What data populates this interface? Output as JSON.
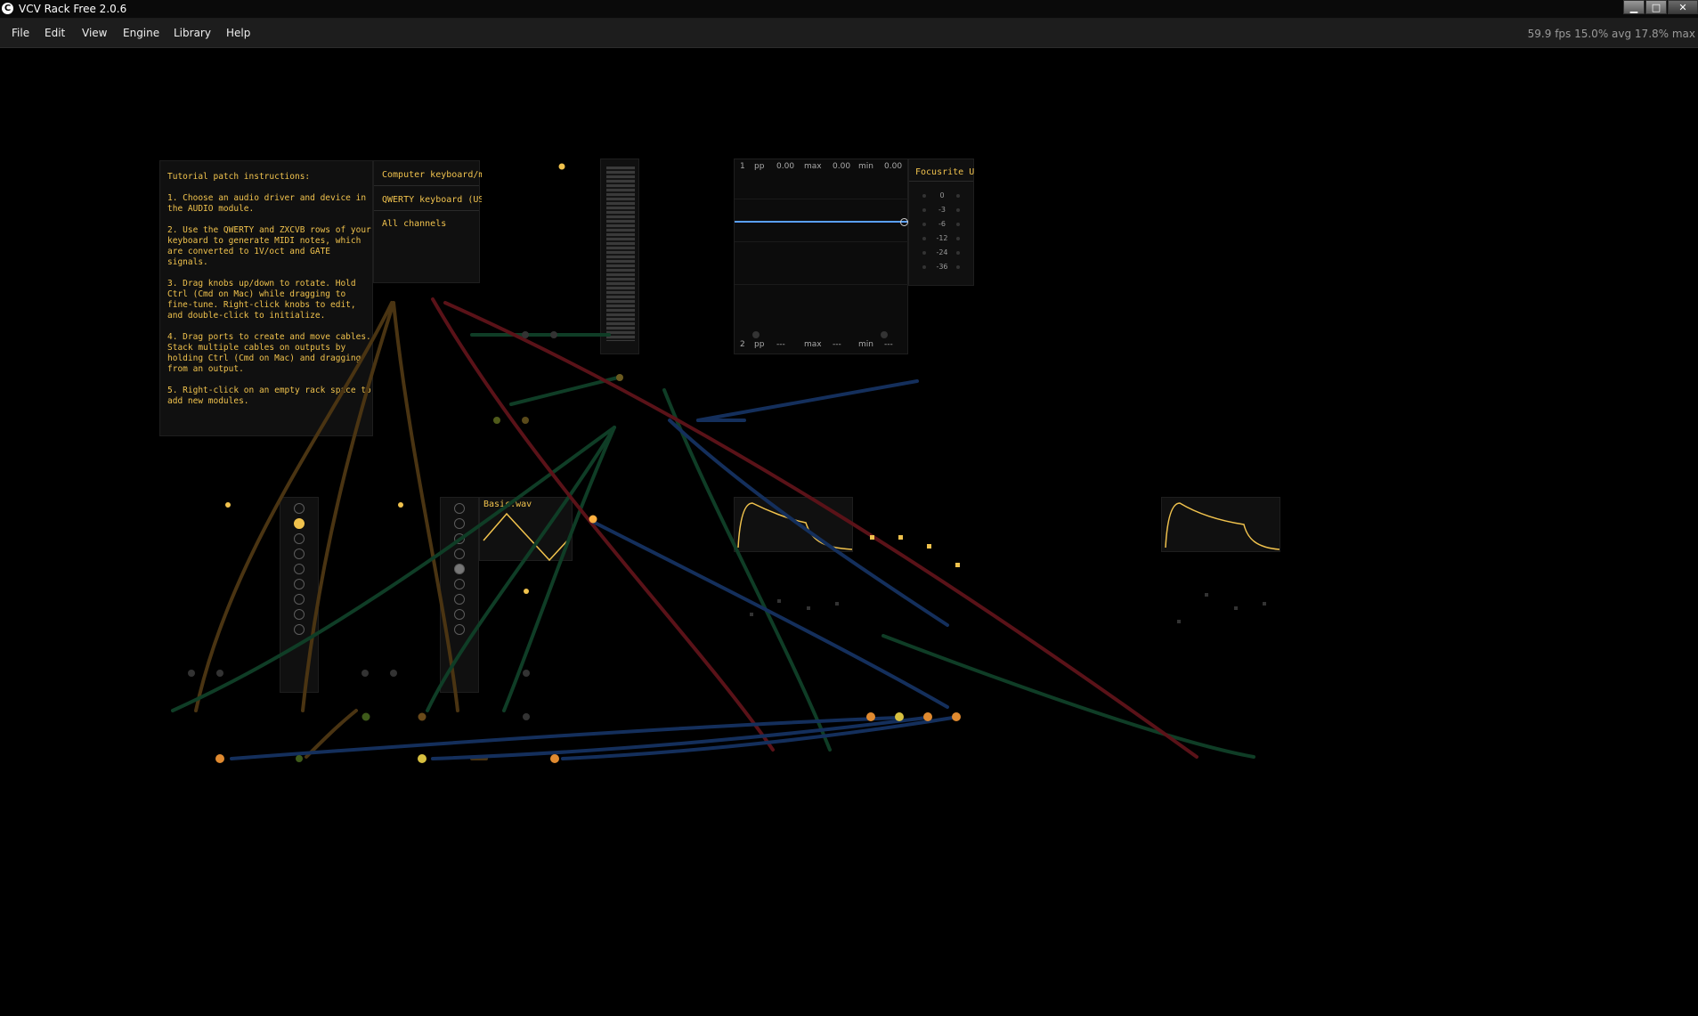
{
  "window": {
    "title": "VCV Rack Free 2.0.6",
    "logo_letter": "C",
    "minimize_glyph": "▁",
    "maximize_glyph": "□",
    "close_glyph": "✕"
  },
  "menu": {
    "file": "File",
    "edit": "Edit",
    "view": "View",
    "engine": "Engine",
    "library": "Library",
    "help": "Help"
  },
  "performance": "59.9 fps  15.0% avg  17.8% max",
  "tutorial": {
    "text": "Tutorial patch instructions:\n\n1. Choose an audio driver and device in the AUDIO module.\n\n2. Use the QWERTY and ZXCVB rows of your keyboard to generate MIDI notes, which are converted to 1V/oct and GATE signals.\n\n3. Drag knobs up/down to rotate. Hold Ctrl (Cmd on Mac) while dragging to fine-tune. Right-click knobs to edit, and double-click to initialize.\n\n4. Drag ports to create and move cables. Stack multiple cables on outputs by holding Ctrl (Cmd on Mac) and dragging from an output.\n\n5. Right-click on an empty rack space to add new modules."
  },
  "midi": {
    "driver": "Computer keyboard/mouse",
    "device": "QWERTY keyboard (US)",
    "channel": "All channels"
  },
  "scope": {
    "ch1": "1",
    "ch2": "2",
    "pp": "pp",
    "max": "max",
    "min": "min",
    "ch1_pp": "0.00",
    "ch1_max": "0.00",
    "ch1_min": "0.00",
    "ch2_pp": "---",
    "ch2_max": "---",
    "ch2_min": "---"
  },
  "audio": {
    "device": "Focusrite USB",
    "meter_labels": [
      "0",
      "-3",
      "-6",
      "-12",
      "-24",
      "-36"
    ]
  },
  "oscillator": {
    "file": "Basic.wav"
  },
  "sequencer": {
    "active_step": 2
  },
  "colors": {
    "accent_yellow": "#f0c24d",
    "cable_green": "#0f3d26",
    "cable_red": "#5a1218",
    "cable_blue": "#142f5c",
    "cable_orange": "#4a3412",
    "scope_trace": "#5aa0ff"
  }
}
